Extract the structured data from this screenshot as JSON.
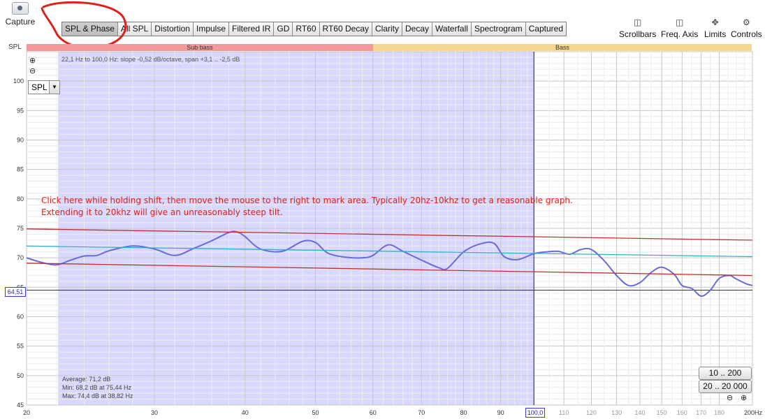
{
  "capture": {
    "label": "Capture",
    "icon": "camera-icon"
  },
  "tabs": [
    {
      "label": "SPL & Phase",
      "active": true
    },
    {
      "label": "All SPL"
    },
    {
      "label": "Distortion"
    },
    {
      "label": "Impulse"
    },
    {
      "label": "Filtered IR"
    },
    {
      "label": "GD"
    },
    {
      "label": "RT60"
    },
    {
      "label": "RT60 Decay"
    },
    {
      "label": "Clarity"
    },
    {
      "label": "Decay"
    },
    {
      "label": "Waterfall"
    },
    {
      "label": "Spectrogram"
    },
    {
      "label": "Captured"
    }
  ],
  "controls": [
    {
      "label": "Scrollbars",
      "icon": "scrollbars-icon"
    },
    {
      "label": "Freq. Axis",
      "icon": "freq-axis-icon"
    },
    {
      "label": "Limits",
      "icon": "limits-icon"
    },
    {
      "label": "Controls",
      "icon": "gear-icon"
    }
  ],
  "axis_label": "SPL",
  "bands": [
    {
      "label": "Sub bass",
      "color": "#f29a9a"
    },
    {
      "label": "Bass",
      "color": "#f7d690"
    }
  ],
  "fit_info": "22,1 Hz to 100,0 Hz: slope -0,52 dB/octave, span +3,1 .. -2,5 dB",
  "selector": {
    "value": "SPL"
  },
  "cursor_y_label": "64,51",
  "cursor_x_label": "100,0",
  "stats": {
    "average": "Average: 71,2 dB",
    "min": "Min: 68,2 dB at 75,44 Hz",
    "max": "Max: 74,4 dB at 38,82 Hz"
  },
  "range_buttons": [
    "10 .. 200",
    "20 .. 20 000"
  ],
  "note": {
    "line1": "Click here while holding shift, then move the mouse to the right to mark area. Typically 20hz-10khz to get a reasonable graph.",
    "line2": "Extending it to 20khz will give an unreasonably steep tilt."
  },
  "colors": {
    "selection": "#d8d8ff",
    "trace": "#6a6ad8",
    "trend": "#2fb0c8",
    "limits": "#c03030",
    "annotation": "#e0201a"
  },
  "chart_data": {
    "type": "line",
    "x_scale": "log",
    "xlim": [
      20,
      200
    ],
    "ylim": [
      45,
      105
    ],
    "x_ticks": [
      "20",
      "30",
      "40",
      "50",
      "60",
      "70",
      "80",
      "90",
      "100,0",
      "110",
      "120",
      "130",
      "140",
      "150",
      "160",
      "170",
      "180",
      "200Hz"
    ],
    "x_tick_values": [
      20,
      30,
      40,
      50,
      60,
      70,
      80,
      90,
      100,
      110,
      120,
      130,
      140,
      150,
      160,
      170,
      180,
      200
    ],
    "y_ticks": [
      "45",
      "50",
      "55",
      "60",
      "65",
      "70",
      "75",
      "80",
      "85",
      "90",
      "95",
      "100"
    ],
    "y_tick_values": [
      45,
      50,
      55,
      60,
      65,
      70,
      75,
      80,
      85,
      90,
      95,
      100
    ],
    "selection": [
      22.1,
      100
    ],
    "cursor_y": 64.51,
    "series": [
      {
        "role": "measurement",
        "x": [
          20,
          21,
          22,
          23,
          24,
          25,
          26,
          28,
          30,
          32,
          34,
          36,
          38,
          39,
          40,
          42,
          45,
          48,
          50,
          52,
          55,
          58,
          60,
          63,
          66,
          70,
          74,
          76,
          80,
          84,
          88,
          91,
          95,
          100,
          104,
          108,
          112,
          116,
          120,
          125,
          130,
          135,
          140,
          145,
          150,
          156,
          160,
          165,
          170,
          175,
          180,
          186,
          190,
          196,
          200
        ],
        "y": [
          70,
          69.2,
          68.8,
          69.6,
          70.3,
          70.4,
          71.2,
          72,
          71.5,
          70.4,
          71.6,
          72.9,
          74.3,
          74.4,
          73.6,
          71.5,
          71.1,
          72.8,
          72.6,
          70.8,
          70.1,
          70.0,
          70.4,
          72.2,
          71.1,
          69.6,
          68.3,
          68.2,
          71.0,
          72.3,
          72.5,
          70.2,
          69.7,
          70.7,
          71.0,
          71.1,
          70.6,
          71.4,
          71.4,
          69.5,
          67.0,
          65.3,
          65.8,
          67.5,
          68.4,
          67.2,
          65.3,
          64.8,
          63.5,
          64.5,
          66.5,
          67.0,
          66.4,
          65.6,
          65.3
        ]
      },
      {
        "role": "trend",
        "x": [
          20,
          200
        ],
        "y": [
          72.0,
          70.2
        ]
      },
      {
        "role": "upper-limit",
        "x": [
          20,
          200
        ],
        "y": [
          74.9,
          73.0
        ]
      },
      {
        "role": "lower-limit",
        "x": [
          20,
          200
        ],
        "y": [
          69.1,
          67.0
        ]
      }
    ]
  }
}
